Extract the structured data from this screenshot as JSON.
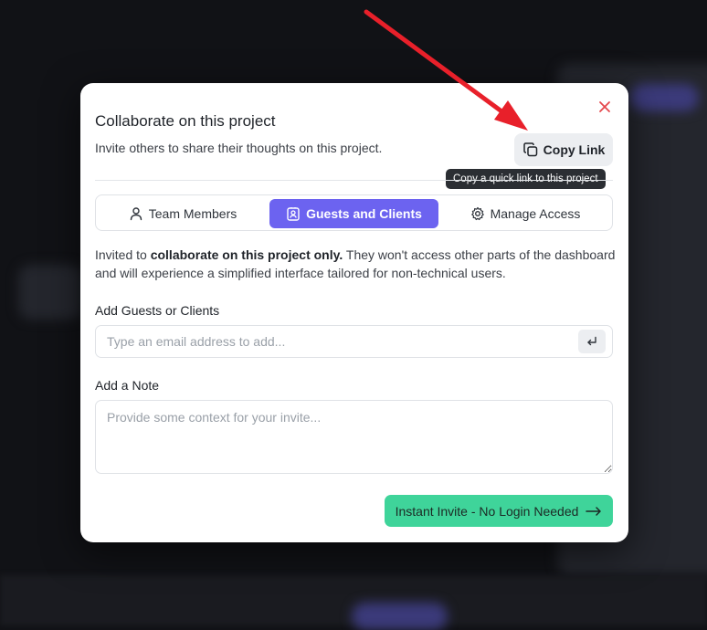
{
  "modal": {
    "title": "Collaborate on this project",
    "subtitle": "Invite others to share their thoughts on this project.",
    "close_icon": "close-icon"
  },
  "copy_link": {
    "label": "Copy Link",
    "icon": "copy-icon",
    "tooltip": "Copy a quick link to this project"
  },
  "tabs": [
    {
      "label": "Team Members",
      "icon": "user-icon",
      "active": false
    },
    {
      "label": "Guests and Clients",
      "icon": "contact-badge-icon",
      "active": true
    },
    {
      "label": "Manage Access",
      "icon": "gear-icon",
      "active": false
    }
  ],
  "info": {
    "prefix": "Invited to ",
    "bold": "collaborate on this project only.",
    "suffix": " They won't access other parts of the dashboard and will experience a simplified interface tailored for non-technical users."
  },
  "guests": {
    "label": "Add Guests or Clients",
    "placeholder": "Type an email address to add...",
    "value": "",
    "enter_icon": "enter-icon"
  },
  "note": {
    "label": "Add a Note",
    "placeholder": "Provide some context for your invite...",
    "value": ""
  },
  "invite_button": {
    "label": "Instant Invite - No Login Needed",
    "icon": "arrow-right-icon"
  },
  "colors": {
    "accent": "#6c63f0",
    "invite_green": "#3fd49a",
    "close_red": "#e5484d",
    "annotation_arrow": "#e8202a"
  }
}
